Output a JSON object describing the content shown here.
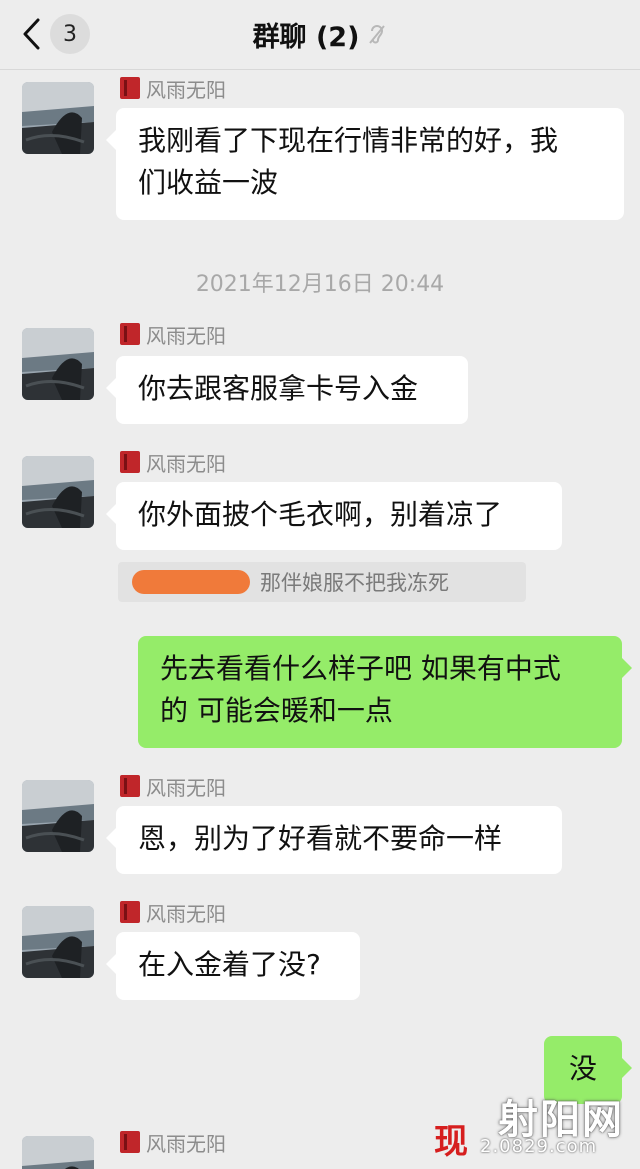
{
  "header": {
    "title": "群聊 (2)",
    "unread_count": "3",
    "back_icon": "chevron-left-icon",
    "mute_icon": "ear-mute-icon"
  },
  "messages": [
    {
      "type": "received",
      "sender": "风雨无阳",
      "lines": [
        "我刚看了下现在行情非常的好，我",
        "们收益一波"
      ]
    },
    {
      "type": "timestamp",
      "text": "2021年12月16日 20:44"
    },
    {
      "type": "received",
      "sender": "风雨无阳",
      "lines": [
        "你去跟客服拿卡号入金"
      ]
    },
    {
      "type": "received",
      "sender": "风雨无阳",
      "lines": [
        "你外面披个毛衣啊，别着凉了"
      ]
    },
    {
      "type": "quote",
      "text": "那伴娘服不把我冻死"
    },
    {
      "type": "sent",
      "lines": [
        "先去看看什么样子吧 如果有中式",
        "的 可能会暖和一点"
      ]
    },
    {
      "type": "received",
      "sender": "风雨无阳",
      "lines": [
        "恩，别为了好看就不要命一样"
      ]
    },
    {
      "type": "received",
      "sender": "风雨无阳",
      "lines": [
        "在入金着了没?"
      ]
    },
    {
      "type": "sent",
      "lines": [
        "没"
      ]
    },
    {
      "type": "received",
      "sender": "风雨无阳",
      "lines": []
    }
  ],
  "watermark": {
    "main": "射阳网",
    "red": "现",
    "url": "2.0829.com"
  },
  "colors": {
    "background": "#ededed",
    "sent_bubble": "#95ec69",
    "received_bubble": "#ffffff",
    "sender_flag": "#c0262a"
  }
}
